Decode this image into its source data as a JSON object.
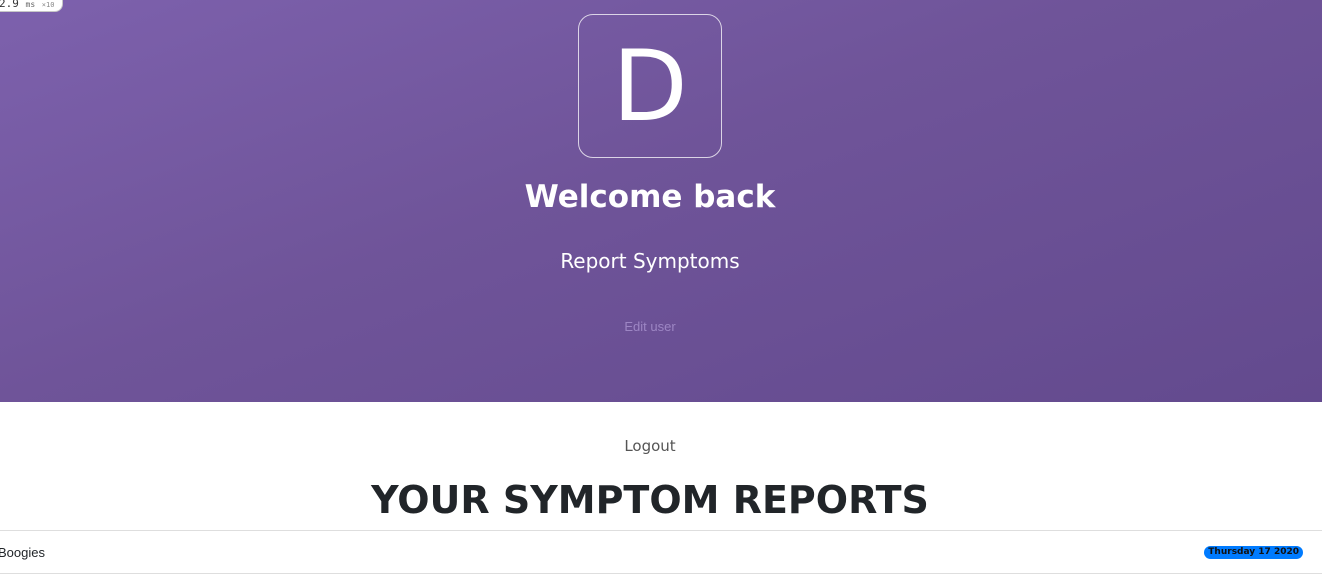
{
  "perf_badge": {
    "value": "2.9",
    "unit": "ms",
    "multiplier": "×10"
  },
  "hero": {
    "logo_letter": "D",
    "title": "Welcome back",
    "report_button": "Report Symptoms",
    "edit_link": "Edit user"
  },
  "logout_label": "Logout",
  "reports_heading": "YOUR SYMPTOM REPORTS",
  "reports": [
    {
      "name": "Boogies",
      "date": "Thursday 17 2020"
    }
  ],
  "colors": {
    "hero_gradient_start": "#7d61ad",
    "hero_gradient_end": "#634a8e",
    "date_badge": "#007bff"
  }
}
